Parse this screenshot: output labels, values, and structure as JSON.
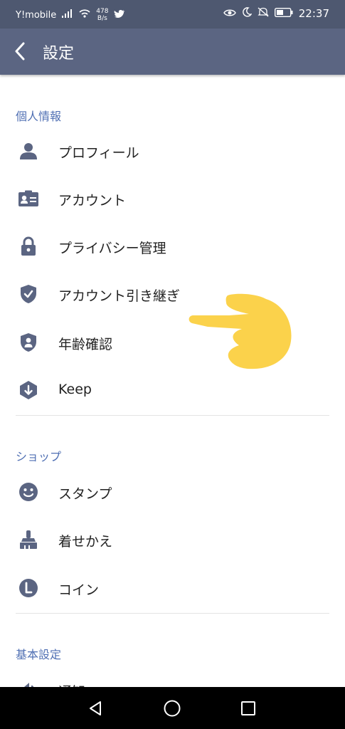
{
  "status_bar": {
    "carrier": "Y!mobile",
    "rate_value": "478",
    "rate_unit": "B/s",
    "time": "22:37"
  },
  "header": {
    "title": "設定"
  },
  "sections": [
    {
      "title": "個人情報",
      "items": [
        "プロフィール",
        "アカウント",
        "プライバシー管理",
        "アカウント引き継ぎ",
        "年齢確認",
        "Keep"
      ]
    },
    {
      "title": "ショップ",
      "items": [
        "スタンプ",
        "着せかえ",
        "コイン"
      ]
    },
    {
      "title": "基本設定",
      "items": [
        "通知"
      ]
    }
  ],
  "colors": {
    "status_bar": "#4e5870",
    "toolbar": "#5b6582",
    "section_header": "#4f6fb3",
    "icon": "#5b6582",
    "pointer": "#fbd24b"
  }
}
